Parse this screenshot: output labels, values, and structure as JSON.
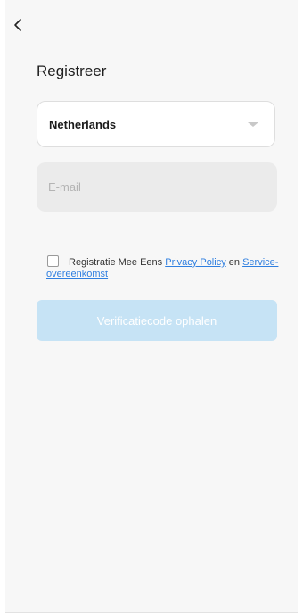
{
  "header": {
    "back_icon": "chevron-left-icon",
    "title": "Registreer"
  },
  "country": {
    "value": "Netherlands",
    "icon": "caret-down-icon"
  },
  "email": {
    "placeholder": "E-mail",
    "value": ""
  },
  "agreement": {
    "checked": false,
    "text_prefix": "Registratie Mee Eens",
    "privacy_link": "Privacy Policy",
    "conjunction": "en",
    "service_link": "Service-overeenkomst"
  },
  "actions": {
    "verify_label": "Verificatiecode ophalen",
    "verify_enabled": false
  },
  "colors": {
    "link": "#2f7fe0",
    "button_disabled": "#c6e3f5",
    "background": "#f7f7f7"
  }
}
